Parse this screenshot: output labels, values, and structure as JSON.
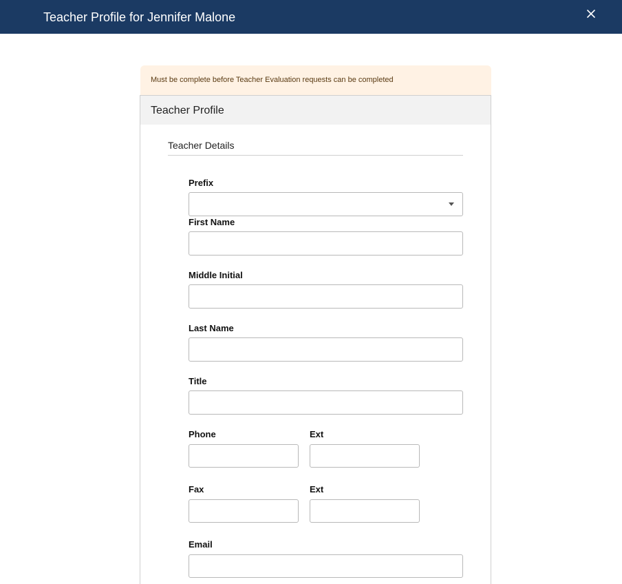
{
  "header": {
    "title": "Teacher Profile for Jennifer Malone",
    "close_icon": "close-icon"
  },
  "notice": {
    "text": "Must be complete before Teacher Evaluation requests can be completed",
    "color": "#fff2e4"
  },
  "panel": {
    "title": "Teacher Profile",
    "section_title": "Teacher Details"
  },
  "form": {
    "prefix": {
      "label": "Prefix",
      "value": ""
    },
    "first_name": {
      "label": "First Name",
      "value": ""
    },
    "middle_initial": {
      "label": "Middle Initial",
      "value": ""
    },
    "last_name": {
      "label": "Last Name",
      "value": ""
    },
    "title": {
      "label": "Title",
      "value": ""
    },
    "phone": {
      "label": "Phone",
      "value": ""
    },
    "phone_ext": {
      "label": "Ext",
      "value": ""
    },
    "fax": {
      "label": "Fax",
      "value": ""
    },
    "fax_ext": {
      "label": "Ext",
      "value": ""
    },
    "email": {
      "label": "Email",
      "value": ""
    }
  },
  "colors": {
    "header_bg": "#1b3a63",
    "panel_head_bg": "#f2f2f2"
  }
}
